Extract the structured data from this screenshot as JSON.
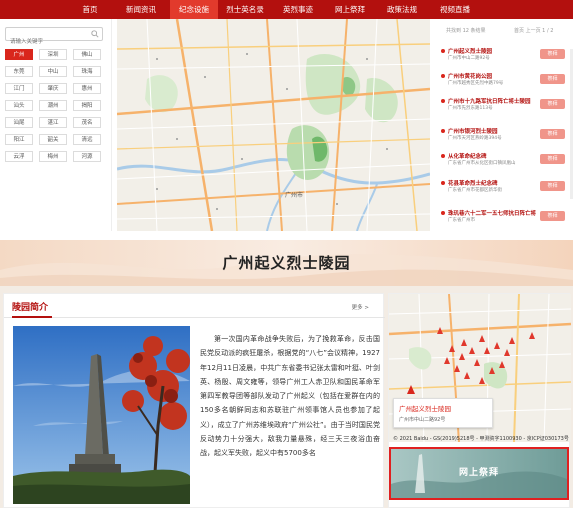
{
  "nav": {
    "items": [
      {
        "label": "首页"
      },
      {
        "label": "新闻资讯"
      },
      {
        "label": "纪念设施"
      },
      {
        "label": "烈士英名录"
      },
      {
        "label": "英烈事迹"
      },
      {
        "label": "网上祭拜"
      },
      {
        "label": "政策法规"
      },
      {
        "label": "视频直播"
      }
    ],
    "active_index": 2,
    "bg_color": "#b3100e",
    "active_color": "#e23a2c"
  },
  "filter": {
    "search_placeholder": "请输入关键字",
    "cities": [
      {
        "label": "广州"
      },
      {
        "label": "深圳"
      },
      {
        "label": "佛山"
      },
      {
        "label": "东莞"
      },
      {
        "label": "中山"
      },
      {
        "label": "珠海"
      },
      {
        "label": "江门"
      },
      {
        "label": "肇庆"
      },
      {
        "label": "惠州"
      },
      {
        "label": "汕头"
      },
      {
        "label": "潮州"
      },
      {
        "label": "揭阳"
      },
      {
        "label": "汕尾"
      },
      {
        "label": "湛江"
      },
      {
        "label": "茂名"
      },
      {
        "label": "阳江"
      },
      {
        "label": "韶关"
      },
      {
        "label": "清远"
      },
      {
        "label": "云浮"
      },
      {
        "label": "梅州"
      },
      {
        "label": "河源"
      }
    ],
    "active_city": "广州"
  },
  "map": {
    "city_label": "广州市"
  },
  "list": {
    "count": "共找到 12 条结果",
    "pager": "首页 上一页 1 / 2",
    "action_label": "祭拜",
    "items": [
      {
        "name": "广州起义烈士陵园",
        "addr": "广州市中山二路92号"
      },
      {
        "name": "广州市黄花岗公园",
        "addr": "广州市越秀区先烈中路79号"
      },
      {
        "name": "广州市十九路军抗日阵亡将士陵园",
        "addr": "广州市先烈东路113号"
      },
      {
        "name": "广州市银河烈士陵园",
        "addr": "广州市天河区燕岭路394号"
      },
      {
        "name": "从化革命纪念碑",
        "addr": "广东省广州市从化区街口镇凤凰山"
      },
      {
        "name": "花县革命烈士纪念碑",
        "addr": "广东省广州市花都区新华街"
      },
      {
        "name": "珠玑巷六十二军一五七师抗日阵亡将士纪念碑",
        "addr": "广东省广州市"
      }
    ]
  },
  "banner": {
    "title": "广州起义烈士陵园"
  },
  "intro": {
    "heading": "陵园简介",
    "more": "更多 >",
    "body": "第一次国内革命战争失败后，为了挽救革命，反击国民党反动派的疯狂屠杀，根据党的“八七”会议精神，1927年12月11日凌晨，中共广东省委书记张太雷和叶挺、叶剑英、杨殷、周文雍等，领导广州工人赤卫队和国民革命军第四军教导团等部队发动了广州起义（包括在爱群在内的150多名朝鲜同志和苏联驻广州领事馆人员也参加了起义），成立了广州苏维埃政府“广州公社”。由于当时国民党反动势力十分强大，敌我力量悬殊，经三天三夜浴血奋战，起义军失败，起义中有5700多名"
  },
  "side": {
    "popup_name": "广州起义烈士陵园",
    "popup_addr": "广州市中山二路92号",
    "copyright": "© 2021 Baidu - GS(2019)5218号 - 甲测资字1100930 - 京ICP证030173号",
    "pray_label": "网上祭拜",
    "highlight_color": "#e02020"
  }
}
